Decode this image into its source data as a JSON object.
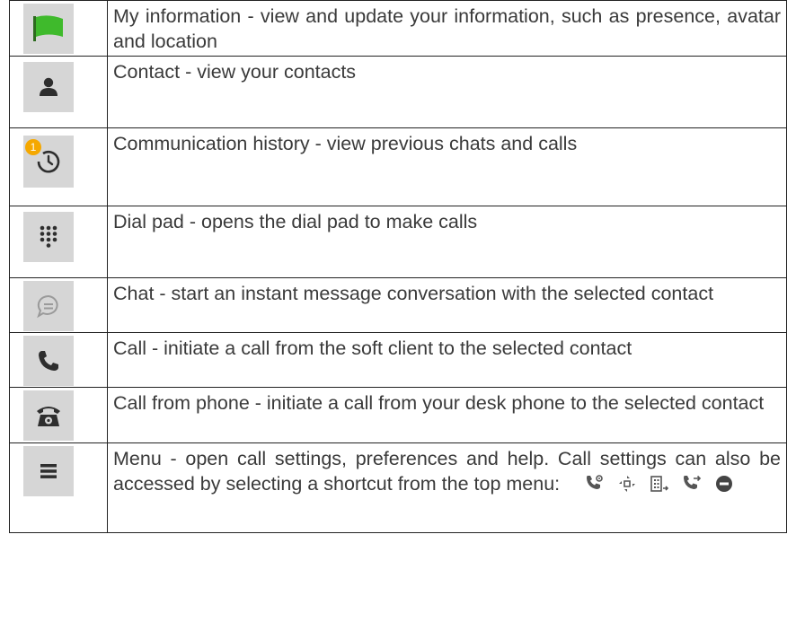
{
  "rows": [
    {
      "icon": "flag-icon",
      "text": "My information - view and update your information, such as presence, avatar and location"
    },
    {
      "icon": "person-icon",
      "text": "Contact - view your contacts"
    },
    {
      "icon": "history-clock-icon",
      "badge": "1",
      "text": "Communication history - view previous chats and calls"
    },
    {
      "icon": "dialpad-icon",
      "text": "Dial pad - opens the dial pad to make calls"
    },
    {
      "icon": "chat-bubble-icon",
      "text": "Chat - start an instant message conversation with the selected contact"
    },
    {
      "icon": "phone-handset-icon",
      "text": "Call - initiate a call from the soft client to the selected contact"
    },
    {
      "icon": "desk-phone-icon",
      "text": "Call from phone - initiate a call from your desk phone to the selected contact"
    },
    {
      "icon": "hamburger-menu-icon",
      "text": "Menu - open call settings, preferences and help. Call settings can also be accessed by selecting a shortcut from the top menu:"
    }
  ],
  "shortcut_icons": [
    "call-settings-icon",
    "call-forward-icon",
    "building-transfer-icon",
    "call-transfer-icon",
    "do-not-disturb-icon"
  ],
  "colors": {
    "flag": "#3fba2c",
    "badge": "#f5a800",
    "icon_bg": "#d6d6d6",
    "icon_dark": "#2e2e2e"
  }
}
